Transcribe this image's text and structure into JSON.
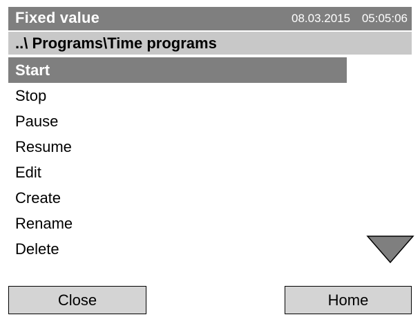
{
  "header": {
    "mode": "Fixed value",
    "datetime": "08.03.2015 05:05:06"
  },
  "breadcrumb": {
    "path": "..\\ Programs\\Time programs"
  },
  "menu": {
    "items": [
      {
        "label": "Start",
        "selected": true
      },
      {
        "label": "Stop"
      },
      {
        "label": "Pause"
      },
      {
        "label": "Resume"
      },
      {
        "label": "Edit"
      },
      {
        "label": "Create"
      },
      {
        "label": "Rename"
      },
      {
        "label": "Delete"
      }
    ],
    "scroll_icon": "triangle-down-icon"
  },
  "footer": {
    "close_label": "Close",
    "home_label": "Home"
  },
  "colors": {
    "title_bg": "#7f7f7f",
    "path_bg": "#c8c8c8",
    "selected_bg": "#7f7f7f",
    "button_bg": "#d4d4d4"
  }
}
